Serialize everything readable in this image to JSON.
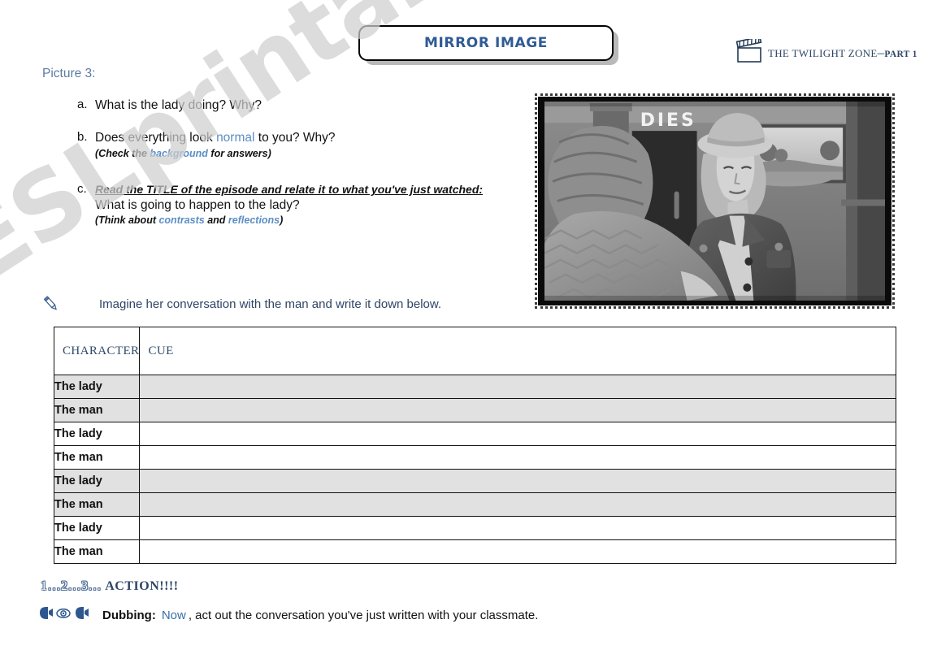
{
  "header": {
    "title": "MIRROR IMAGE",
    "show_name": "THE TWILIGHT ZONE",
    "show_dash": "–",
    "show_part": "PART 1",
    "clapper_icon": "clapperboard-icon"
  },
  "worksheet": {
    "picture_label": "Picture 3:",
    "questions": [
      {
        "marker": "a.",
        "main_before": "What is the lady doing? Why?",
        "accent": "",
        "main_after": "",
        "sub_before": "",
        "sub_accent": "",
        "sub_after": ""
      },
      {
        "marker": "b.",
        "main_before": "Does everything look ",
        "accent": "normal",
        "main_after": " to you? Why?",
        "sub_before": "(Check the ",
        "sub_accent": "background",
        "sub_after": " for answers)"
      },
      {
        "marker": "c.",
        "heading": "Read the TITLE of the episode and relate it to what you've just watched:",
        "main_before": "What is going to happen to the lady?",
        "sub_before": "(Think about ",
        "sub_accent": "contrasts",
        "sub_mid": " and ",
        "sub_accent2": "reflections",
        "sub_after": ")"
      }
    ]
  },
  "photo": {
    "caption_sign": "DIES",
    "alt_name": "twilight-zone-still-photo"
  },
  "instruction": {
    "icon": "pencil-icon",
    "text": "Imagine her conversation with the man and write it down below."
  },
  "table": {
    "columns": [
      "CHARACTER",
      "CUE"
    ],
    "rows": [
      {
        "character": "The lady",
        "cue": "",
        "shaded": true
      },
      {
        "character": "The man",
        "cue": "",
        "shaded": true
      },
      {
        "character": "The lady",
        "cue": "",
        "shaded": false
      },
      {
        "character": "The man",
        "cue": "",
        "shaded": false
      },
      {
        "character": "The lady",
        "cue": "",
        "shaded": true
      },
      {
        "character": "The man",
        "cue": "",
        "shaded": true
      },
      {
        "character": "The lady",
        "cue": "",
        "shaded": false
      },
      {
        "character": "The man",
        "cue": "",
        "shaded": false
      }
    ]
  },
  "footer": {
    "action_numbers": "1…2…3…",
    "action_word": "ACTION!!!!",
    "dub_icons": [
      "speaking-head-icon",
      "eye-icon",
      "speaking-head-icon"
    ],
    "dub_label": "Dubbing:",
    "dub_now": "Now",
    "dub_rest": ", act out the conversation you've just written with your classmate."
  },
  "watermark": {
    "text": "ESLprintables.com"
  },
  "colors": {
    "title_blue": "#2f5b96",
    "heading_blue": "#2e4566",
    "accent_blue": "#5b8ec4",
    "picture_label_blue": "#5b7ba6",
    "row_shade": "#e1e1e1",
    "watermark_grey": "#cfcfcf"
  }
}
